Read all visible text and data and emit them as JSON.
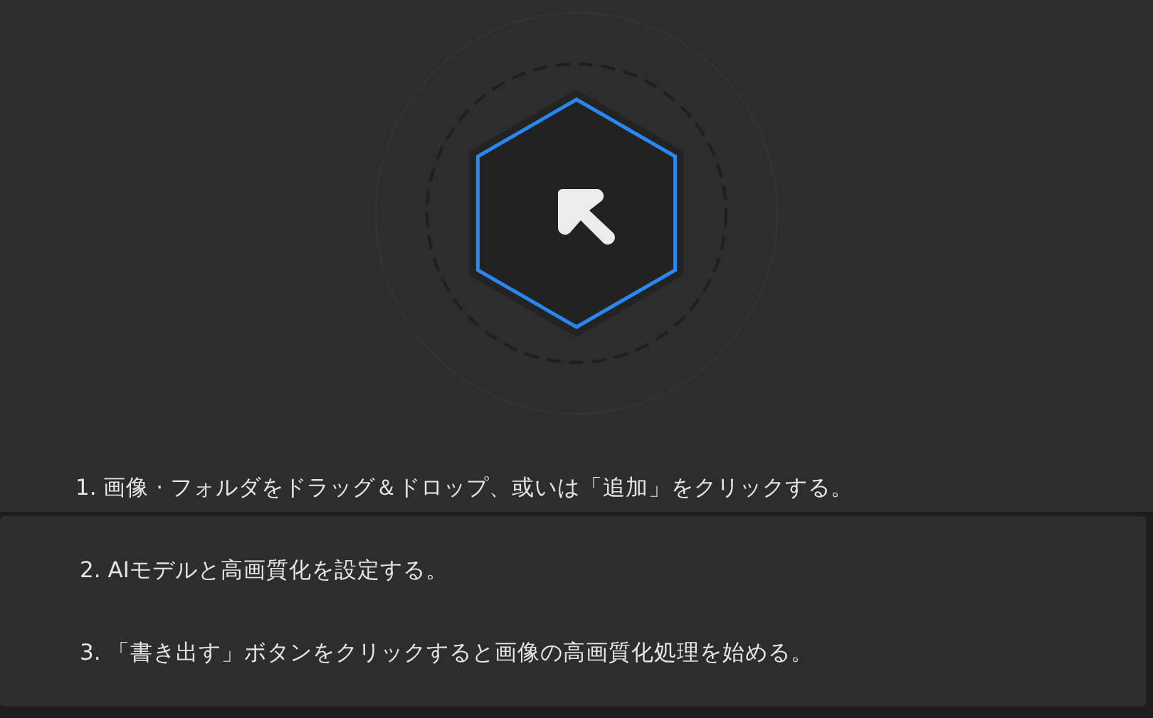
{
  "drop_zone": {
    "hint": "1. 画像 · フォルダをドラッグ＆ドロップ、或いは「追加」をクリックする。"
  },
  "steps": [
    "2. AIモデルと高画質化を設定する。",
    "3. 「書き出す」ボタンをクリックすると画像の高画質化処理を始める。"
  ]
}
